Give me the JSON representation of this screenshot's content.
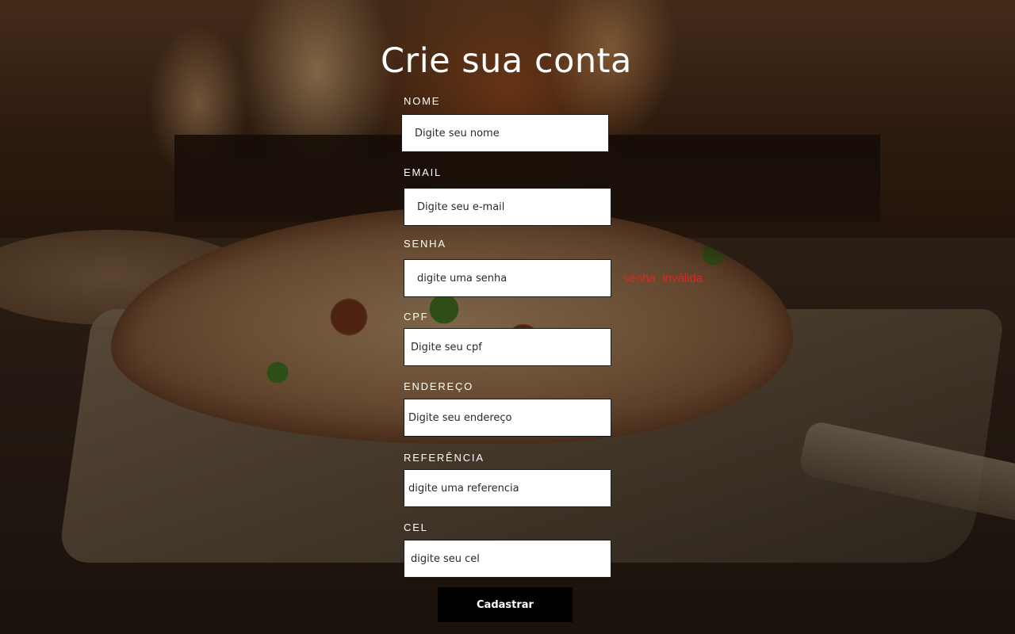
{
  "page": {
    "title": "Crie sua conta"
  },
  "form": {
    "fields": [
      {
        "label": "NOME",
        "placeholder": "Digite seu nome",
        "value": ""
      },
      {
        "label": "EMAIL",
        "placeholder": "Digite seu e-mail",
        "value": ""
      },
      {
        "label": "SENHA",
        "placeholder": "digite uma senha",
        "value": ""
      },
      {
        "label": "CPF",
        "placeholder": "Digite seu cpf",
        "value": ""
      },
      {
        "label": "ENDEREÇO",
        "placeholder": "Digite seu endereço",
        "value": ""
      },
      {
        "label": "REFERÊNCIA",
        "placeholder": "digite uma referencia",
        "value": ""
      },
      {
        "label": "CEL",
        "placeholder": "digite seu cel",
        "value": ""
      }
    ],
    "password_error": "senha  inválida",
    "submit_label": "Cadastrar"
  },
  "colors": {
    "error": "#e0261c",
    "button_bg": "#000000",
    "text_on_bg": "#ffffff"
  }
}
